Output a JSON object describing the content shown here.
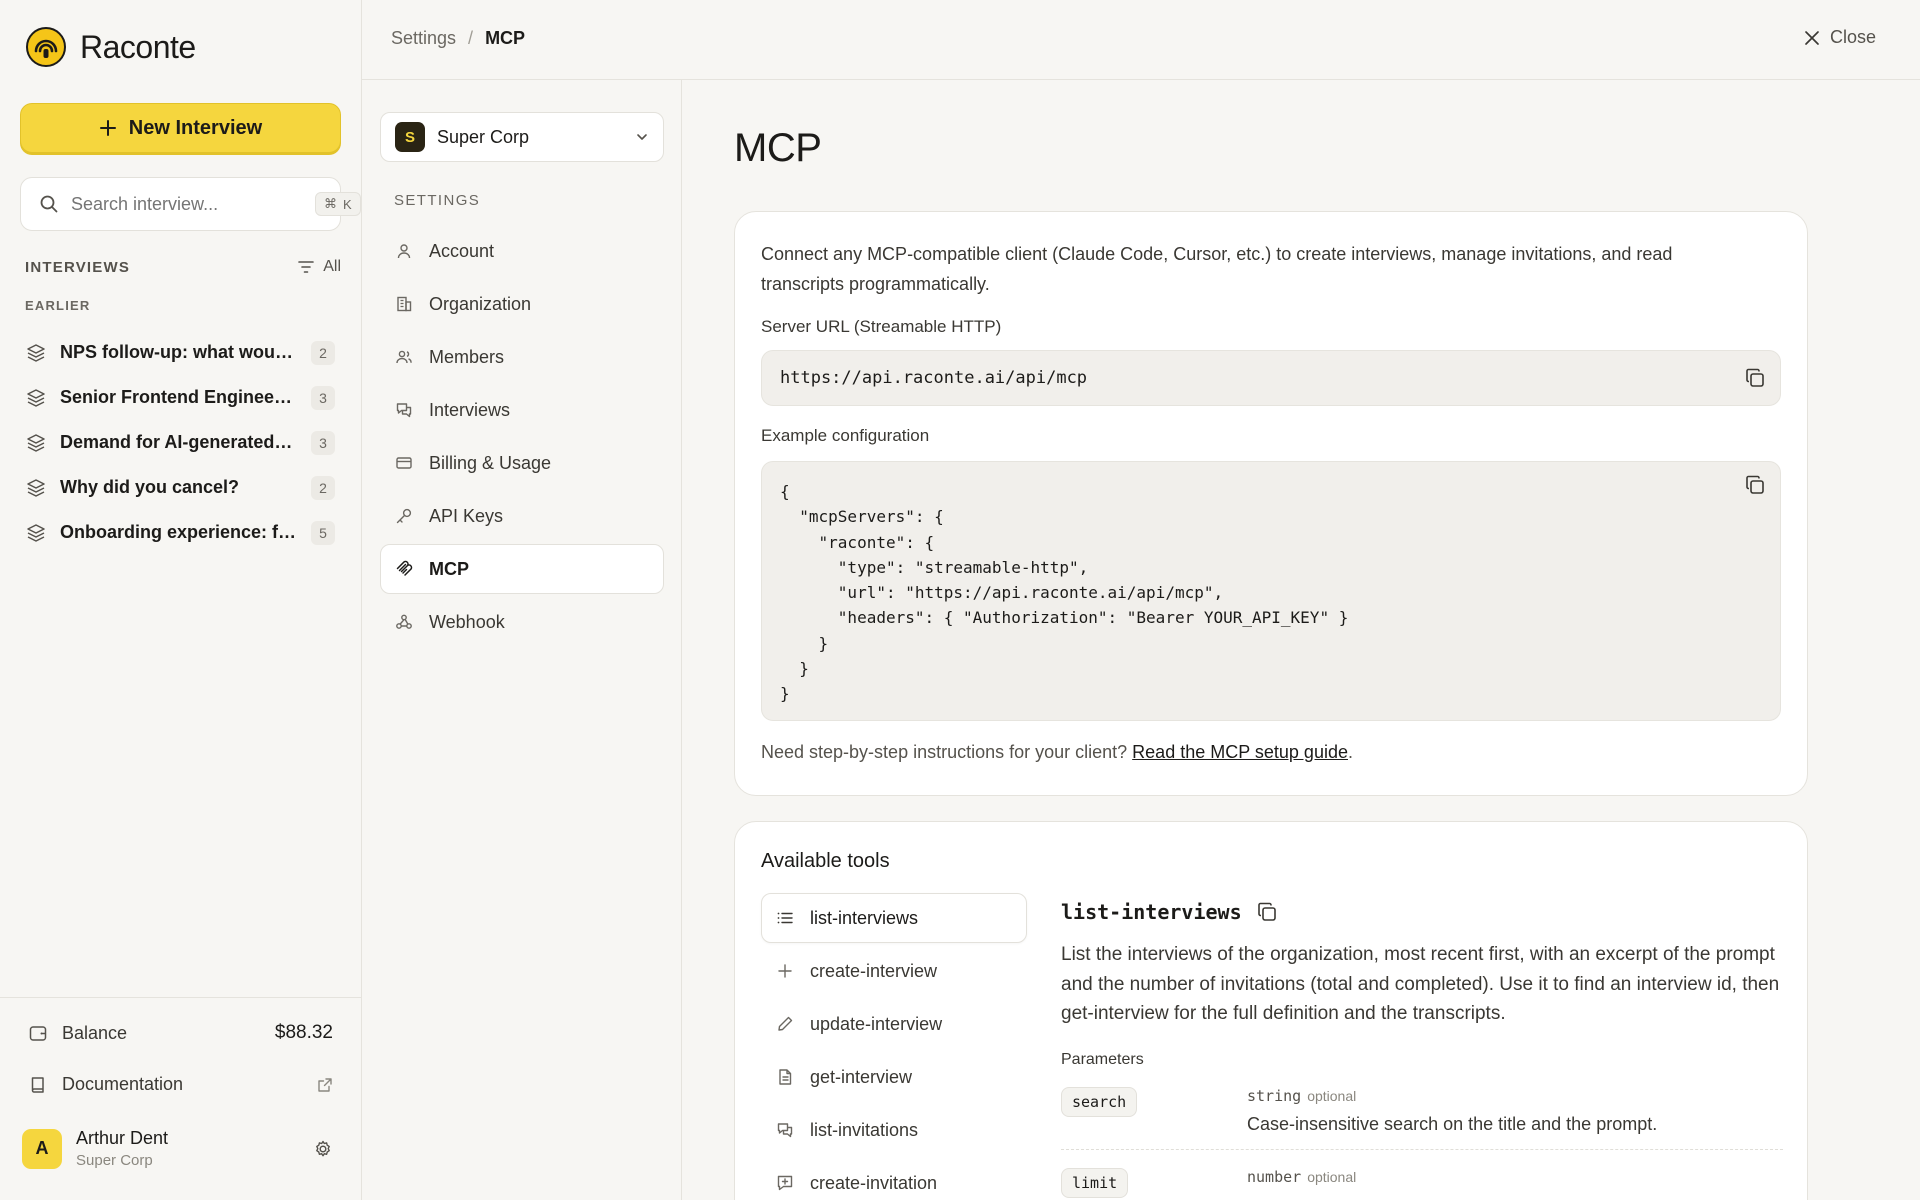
{
  "app": {
    "name": "Raconte"
  },
  "sidebar": {
    "new_button_label": "New Interview",
    "search": {
      "placeholder": "Search interview...",
      "shortcut_symbol": "⌘",
      "shortcut_key": "K"
    },
    "section_title": "INTERVIEWS",
    "filter_label": "All",
    "group_label": "EARLIER",
    "interviews": [
      {
        "title": "NPS follow-up: what would make you recommend us?",
        "count": "2"
      },
      {
        "title": "Senior Frontend Engineer interview",
        "count": "3"
      },
      {
        "title": "Demand for AI-generated reports",
        "count": "3"
      },
      {
        "title": "Why did you cancel?",
        "count": "2"
      },
      {
        "title": "Onboarding experience: first week",
        "count": "5"
      }
    ],
    "balance_label": "Balance",
    "balance_value": "$88.32",
    "docs_label": "Documentation",
    "user": {
      "initial": "A",
      "name": "Arthur Dent",
      "org": "Super Corp"
    }
  },
  "topbar": {
    "crumb_root": "Settings",
    "crumb_sep": "/",
    "crumb_current": "MCP",
    "close_label": "Close"
  },
  "settings_nav": {
    "org": {
      "initial": "S",
      "name": "Super Corp"
    },
    "title": "SETTINGS",
    "items": [
      {
        "label": "Account",
        "icon": "user-icon"
      },
      {
        "label": "Organization",
        "icon": "building-icon"
      },
      {
        "label": "Members",
        "icon": "users-icon"
      },
      {
        "label": "Interviews",
        "icon": "chat-icon"
      },
      {
        "label": "Billing & Usage",
        "icon": "card-icon"
      },
      {
        "label": "API Keys",
        "icon": "key-icon"
      },
      {
        "label": "MCP",
        "icon": "mcp-icon",
        "active": true
      },
      {
        "label": "Webhook",
        "icon": "webhook-icon"
      }
    ]
  },
  "main": {
    "title": "MCP",
    "intro": "Connect any MCP-compatible client (Claude Code, Cursor, etc.) to create interviews, manage invitations, and read transcripts programmatically.",
    "server_url_label": "Server URL (Streamable HTTP)",
    "server_url": "https://api.raconte.ai/api/mcp",
    "example_label": "Example configuration",
    "example_code": "{\n  \"mcpServers\": {\n    \"raconte\": {\n      \"type\": \"streamable-http\",\n      \"url\": \"https://api.raconte.ai/api/mcp\",\n      \"headers\": { \"Authorization\": \"Bearer YOUR_API_KEY\" }\n    }\n  }\n}",
    "footnote_text": "Need step-by-step instructions for your client? ",
    "footnote_link": "Read the MCP setup guide",
    "footnote_end": ".",
    "tools_title": "Available tools",
    "tools": [
      {
        "label": "list-interviews",
        "icon": "list-icon",
        "active": true
      },
      {
        "label": "create-interview",
        "icon": "plus-icon"
      },
      {
        "label": "update-interview",
        "icon": "pencil-icon"
      },
      {
        "label": "get-interview",
        "icon": "file-icon"
      },
      {
        "label": "list-invitations",
        "icon": "chat-icon"
      },
      {
        "label": "create-invitation",
        "icon": "message-plus-icon"
      }
    ],
    "tool_detail": {
      "name": "list-interviews",
      "description": "List the interviews of the organization, most recent first, with an excerpt of the prompt and the number of invitations (total and completed). Use it to find an interview id, then get-interview for the full definition and the transcripts.",
      "params_title": "Parameters",
      "params": [
        {
          "name": "search",
          "type": "string",
          "optional": "optional",
          "desc": "Case-insensitive search on the title and the prompt."
        },
        {
          "name": "limit",
          "type": "number",
          "optional": "optional",
          "desc": ""
        }
      ]
    }
  },
  "colors": {
    "accent": "#f5d63e",
    "background": "#f7f6f3",
    "card": "#ffffff"
  }
}
